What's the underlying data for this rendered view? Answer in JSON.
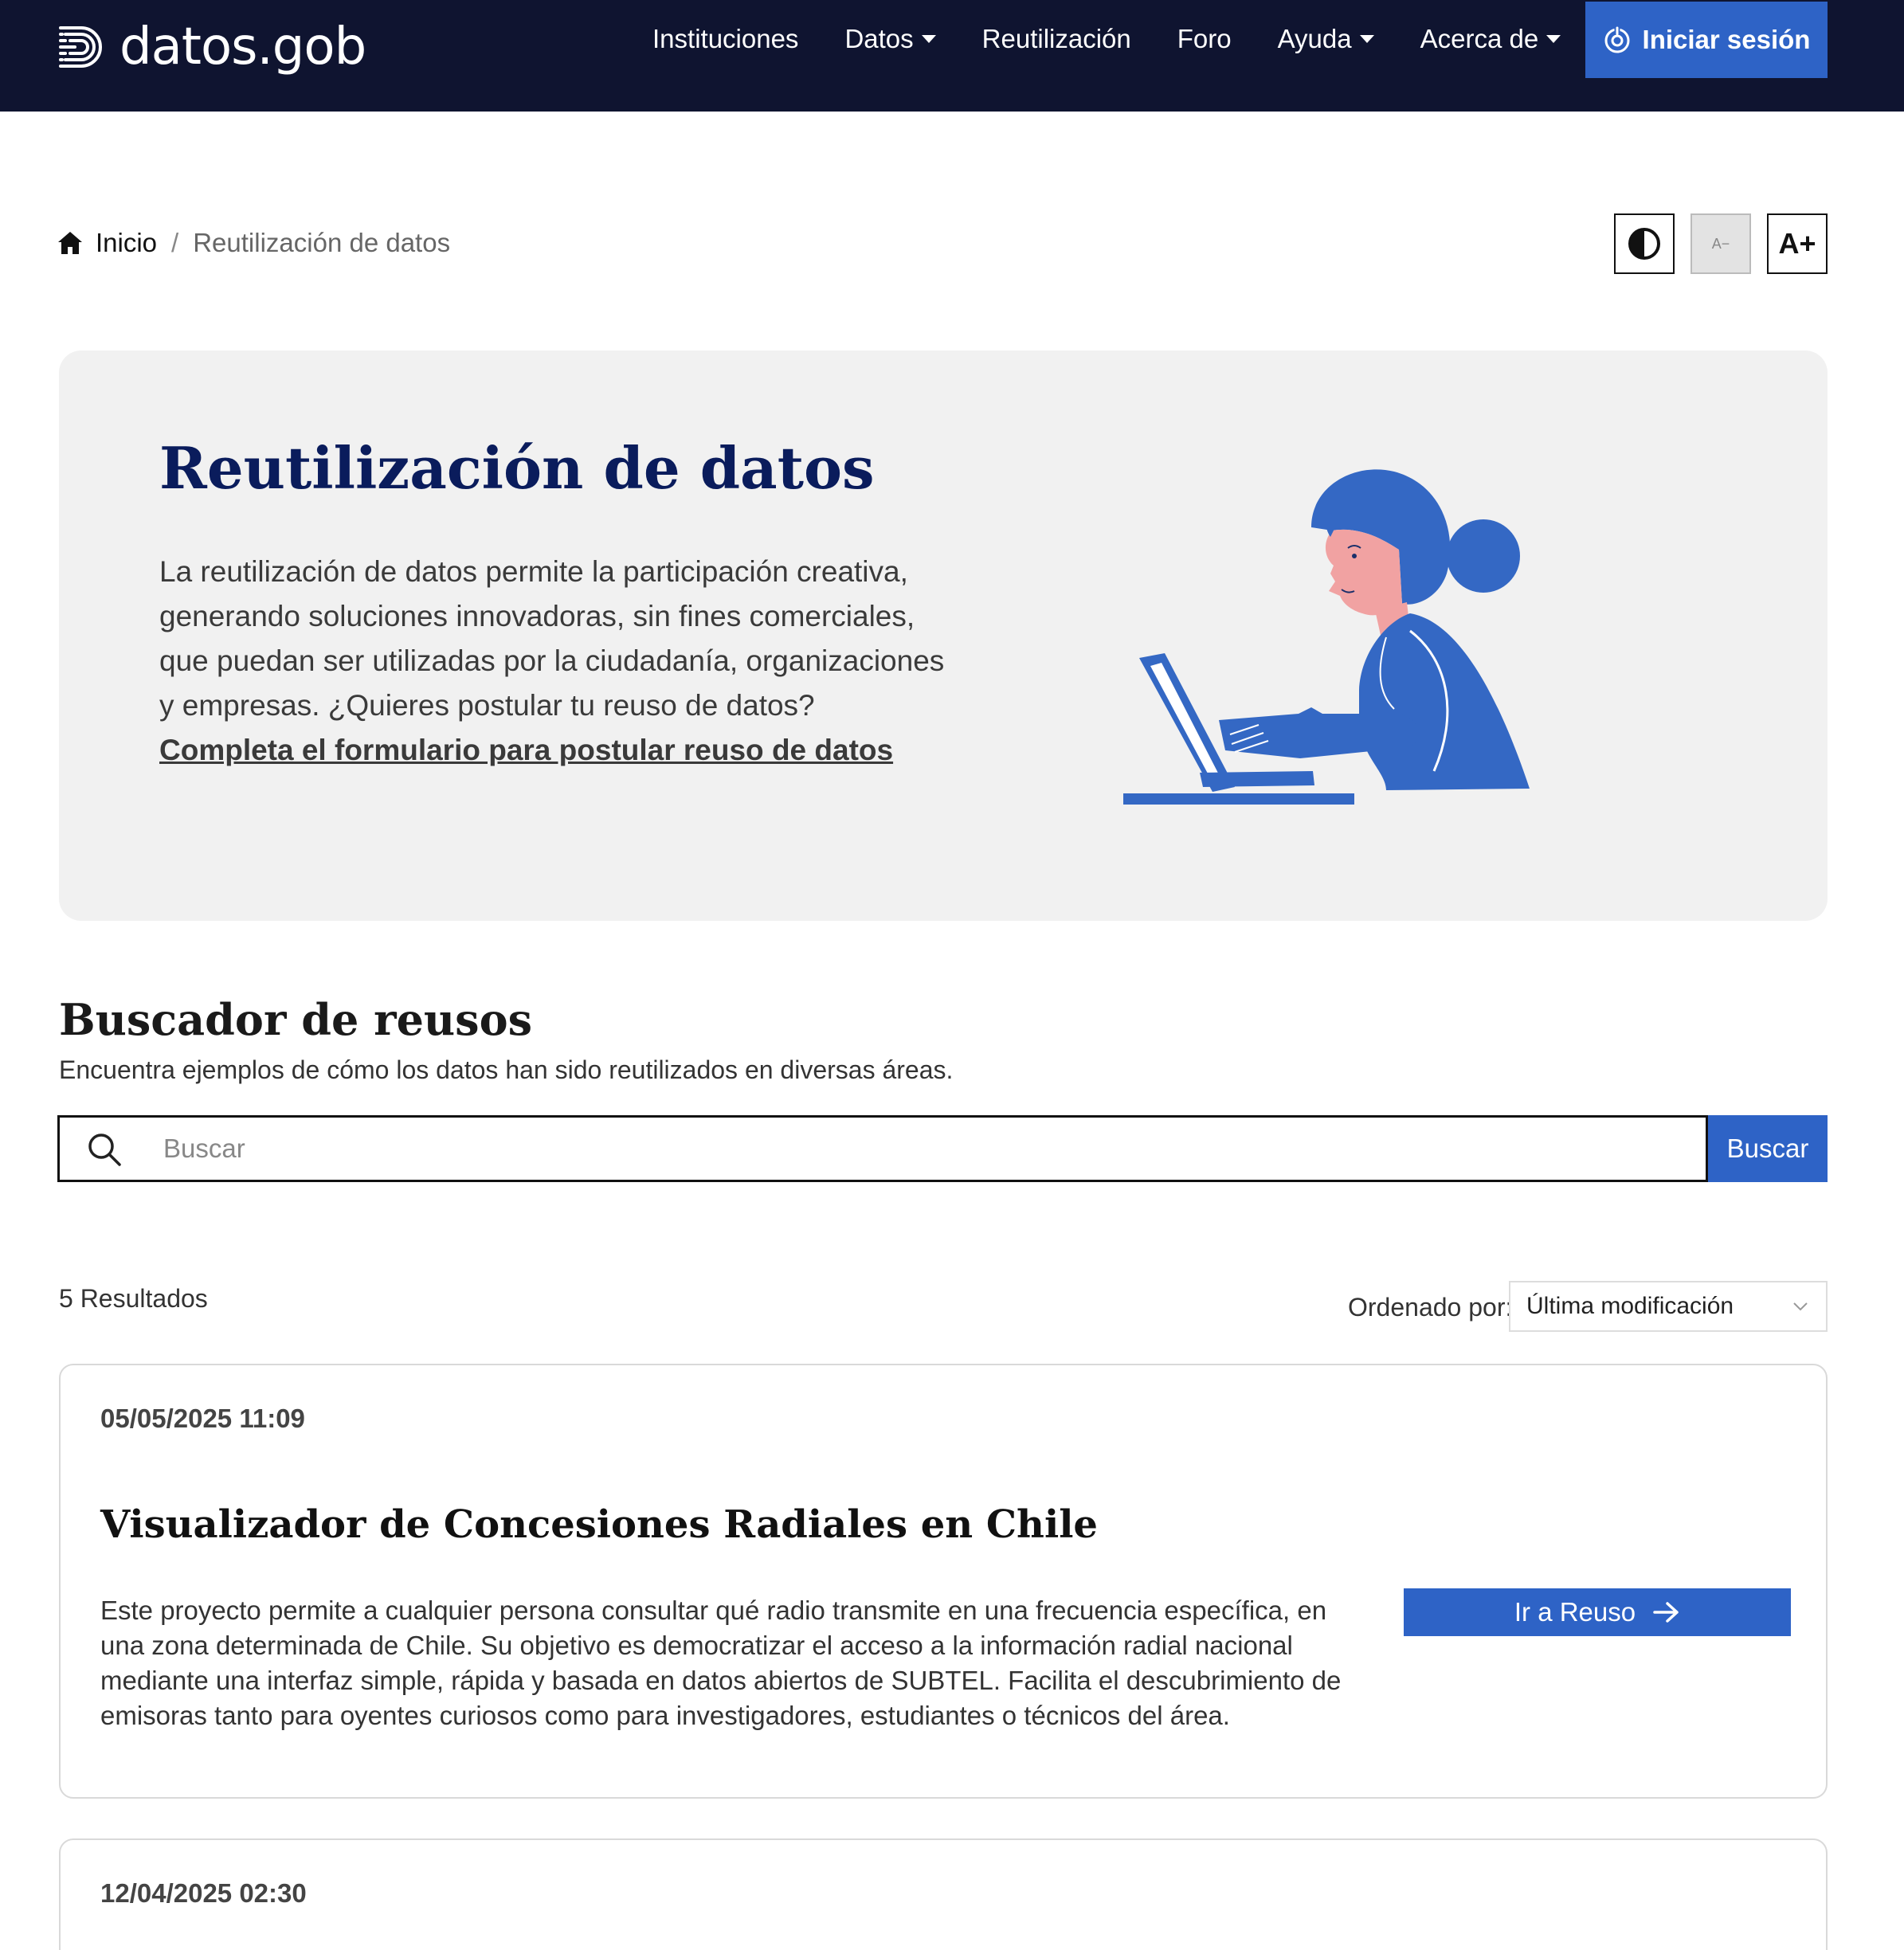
{
  "header": {
    "logo_text": "datos.gob",
    "nav": [
      {
        "label": "Instituciones",
        "dropdown": false
      },
      {
        "label": "Datos",
        "dropdown": true
      },
      {
        "label": "Reutilización",
        "dropdown": false
      },
      {
        "label": "Foro",
        "dropdown": false
      },
      {
        "label": "Ayuda",
        "dropdown": true
      },
      {
        "label": "Acerca de",
        "dropdown": true
      }
    ],
    "login_label": "Iniciar sesión"
  },
  "breadcrumb": {
    "home": "Inicio",
    "separator": "/",
    "current": "Reutilización de datos"
  },
  "accessibility": {
    "contrast_icon": "contrast-icon",
    "decrease_label": "A−",
    "increase_label": "A+"
  },
  "hero": {
    "title": "Reutilización de datos",
    "text": "La reutilización de datos permite la participación creativa, generando soluciones innovadoras, sin fines comerciales, que puedan ser utilizadas por la ciudadanía, organizaciones y empresas. ¿Quieres postular tu reuso de datos? ",
    "link": "Completa el formulario para postular reuso de datos"
  },
  "search": {
    "title": "Buscador de reusos",
    "subtitle": "Encuentra ejemplos de cómo los datos han sido reutilizados en diversas áreas.",
    "placeholder": "Buscar",
    "button": "Buscar"
  },
  "results": {
    "count": "5 Resultados",
    "sort_label": "Ordenado por:",
    "sort_value": "Última modificación"
  },
  "cards": [
    {
      "date": "05/05/2025 11:09",
      "title": "Visualizador de Concesiones Radiales en Chile",
      "description": "Este proyecto permite a cualquier persona consultar qué radio transmite en una frecuencia específica, en una zona determinada de Chile. Su objetivo es democratizar el acceso a la información radial nacional mediante una interfaz simple, rápida y basada en datos abiertos de SUBTEL. Facilita el descubrimiento de emisoras tanto para oyentes curiosos como para investigadores, estudiantes o técnicos del área.",
      "button": "Ir a Reuso"
    },
    {
      "date": "12/04/2025 02:30"
    }
  ],
  "colors": {
    "navbar": "#0f1430",
    "primary": "#2e63c6",
    "hero_bg": "#f1f1f1",
    "title_navy": "#0a1c5c"
  }
}
